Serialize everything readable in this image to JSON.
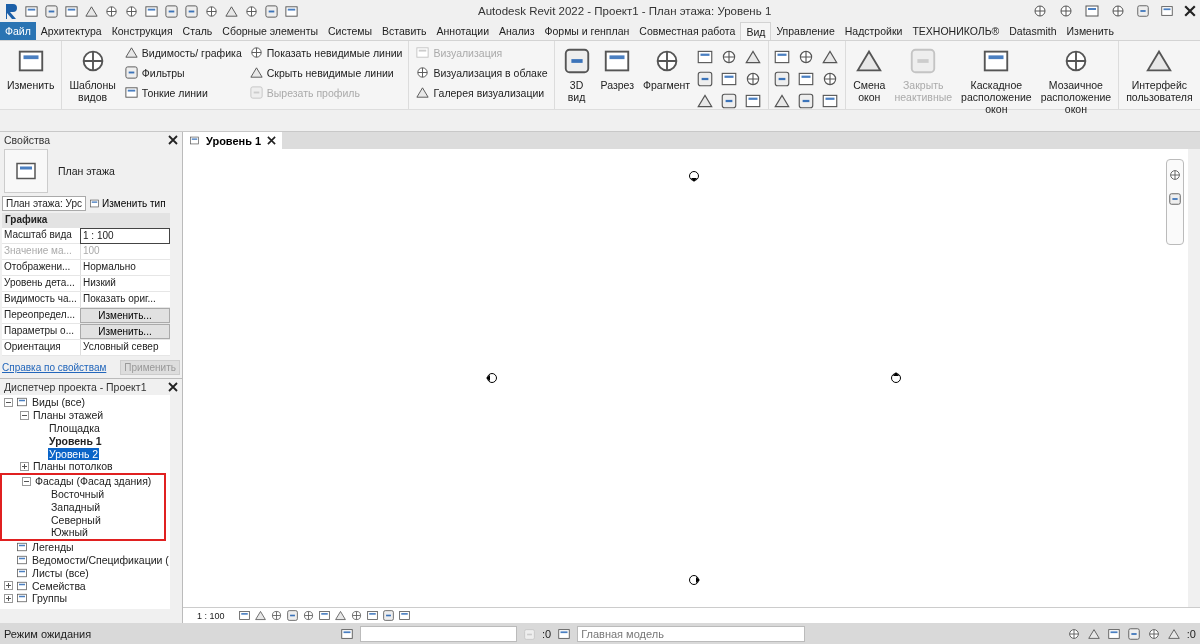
{
  "window": {
    "title": "Autodesk Revit 2022 - Проект1 - План этажа: Уровень 1"
  },
  "ribbon_tabs": [
    {
      "label": "Файл",
      "kind": "app",
      "selected": false
    },
    {
      "label": "Архитектура",
      "kind": "tab",
      "selected": false
    },
    {
      "label": "Конструкция",
      "kind": "tab",
      "selected": false
    },
    {
      "label": "Сталь",
      "kind": "tab",
      "selected": false
    },
    {
      "label": "Сборные элементы",
      "kind": "tab",
      "selected": false
    },
    {
      "label": "Системы",
      "kind": "tab",
      "selected": false
    },
    {
      "label": "Вставить",
      "kind": "tab",
      "selected": false
    },
    {
      "label": "Аннотации",
      "kind": "tab",
      "selected": false
    },
    {
      "label": "Анализ",
      "kind": "tab",
      "selected": false
    },
    {
      "label": "Формы и генплан",
      "kind": "tab",
      "selected": false
    },
    {
      "label": "Совместная работа",
      "kind": "tab",
      "selected": false
    },
    {
      "label": "Вид",
      "kind": "tab",
      "selected": true
    },
    {
      "label": "Управление",
      "kind": "tab",
      "selected": false
    },
    {
      "label": "Надстройки",
      "kind": "tab",
      "selected": false
    },
    {
      "label": "ТЕХНОНИКОЛЬ®",
      "kind": "tab",
      "selected": false
    },
    {
      "label": "Datasmith",
      "kind": "tab",
      "selected": false
    },
    {
      "label": "Изменить",
      "kind": "tab",
      "selected": false
    }
  ],
  "ribbon_groups": [
    {
      "items": [
        {
          "kind": "large",
          "label": "Изменить",
          "disabled": false
        }
      ]
    },
    {
      "items": [
        {
          "kind": "large",
          "label": "Шаблоны видов",
          "disabled": false
        },
        {
          "kind": "stack",
          "items": [
            {
              "label": "Видимость/ графика",
              "disabled": false
            },
            {
              "label": "Фильтры",
              "disabled": false
            },
            {
              "label": "Тонкие линии",
              "disabled": false
            }
          ]
        },
        {
          "kind": "stack",
          "items": [
            {
              "label": "Показать невидимые линии",
              "disabled": false
            },
            {
              "label": "Скрыть невидимые линии",
              "disabled": false
            },
            {
              "label": "Вырезать профиль",
              "disabled": true
            }
          ]
        }
      ]
    },
    {
      "items": [
        {
          "kind": "stack",
          "items": [
            {
              "label": "Визуализация",
              "disabled": true
            },
            {
              "label": "Визуализация  в облаке",
              "disabled": false
            },
            {
              "label": "Галерея  визуализации",
              "disabled": false
            }
          ]
        }
      ]
    },
    {
      "items": [
        {
          "kind": "large",
          "label": "3D вид",
          "disabled": false
        },
        {
          "kind": "large",
          "label": "Разрез",
          "disabled": false
        },
        {
          "kind": "large",
          "label": "Фрагмент",
          "disabled": false
        },
        {
          "kind": "icons"
        }
      ]
    },
    {
      "items": [
        {
          "kind": "icons"
        }
      ]
    },
    {
      "items": [
        {
          "kind": "large",
          "label": "Смена окон",
          "disabled": false
        },
        {
          "kind": "large",
          "label": "Закрыть неактивные",
          "disabled": true
        },
        {
          "kind": "large",
          "label": "Каскадное расположение окон",
          "disabled": false
        },
        {
          "kind": "large",
          "label": "Мозаичное расположение окон",
          "disabled": false
        }
      ]
    },
    {
      "items": [
        {
          "kind": "large",
          "label": "Интерфейс пользователя",
          "disabled": false
        }
      ]
    }
  ],
  "properties": {
    "title": "Свойства",
    "type_name": "План этажа",
    "instance_selector": "План этажа: Урс",
    "edit_type": "Изменить тип",
    "section": "Графика",
    "rows": [
      {
        "label": "Масштаб вида",
        "value": "1 : 100",
        "kind": "input",
        "disabled": false
      },
      {
        "label": "Значение ма...",
        "value": "100",
        "kind": "text",
        "disabled": true
      },
      {
        "label": "Отображени...",
        "value": "Нормально",
        "kind": "text",
        "disabled": false
      },
      {
        "label": "Уровень дета...",
        "value": "Низкий",
        "kind": "text",
        "disabled": false
      },
      {
        "label": "Видимость ча...",
        "value": "Показать ориг...",
        "kind": "text",
        "disabled": false
      },
      {
        "label": "Переопредел...",
        "value": "Изменить...",
        "kind": "button",
        "disabled": false
      },
      {
        "label": "Параметры о...",
        "value": "Изменить...",
        "kind": "button",
        "disabled": false
      },
      {
        "label": "Ориентация",
        "value": "Условный север",
        "kind": "text",
        "disabled": false
      }
    ],
    "help_link": "Справка по свойствам",
    "apply_button": {
      "label": "Применить",
      "disabled": true
    }
  },
  "project_browser": {
    "title": "Диспетчер проекта - Проект1",
    "tree": [
      {
        "label": "Виды (все)",
        "expanded": true,
        "selected": false,
        "current": false,
        "highlighted": false,
        "children": [
          {
            "label": "Планы этажей",
            "expanded": true,
            "selected": false,
            "current": false,
            "highlighted": false,
            "children": [
              {
                "label": "Площадка",
                "selected": false,
                "current": false,
                "highlighted": false
              },
              {
                "label": "Уровень 1",
                "selected": false,
                "current": true,
                "highlighted": false
              },
              {
                "label": "Уровень 2",
                "selected": true,
                "current": false,
                "highlighted": false
              }
            ]
          },
          {
            "label": "Планы потолков",
            "expanded": false,
            "selected": false,
            "current": false,
            "highlighted": false
          },
          {
            "label": "Фасады (Фасад здания)",
            "expanded": true,
            "selected": false,
            "current": false,
            "highlighted": true,
            "children": [
              {
                "label": "Восточный",
                "selected": false,
                "current": false,
                "highlighted": false
              },
              {
                "label": "Западный",
                "selected": false,
                "current": false,
                "highlighted": false
              },
              {
                "label": "Северный",
                "selected": false,
                "current": false,
                "highlighted": false
              },
              {
                "label": "Южный",
                "selected": false,
                "current": false,
                "highlighted": false
              }
            ]
          }
        ]
      },
      {
        "label": "Легенды",
        "selected": false,
        "current": false,
        "highlighted": false
      },
      {
        "label": "Ведомости/Спецификации (",
        "selected": false,
        "current": false,
        "highlighted": false
      },
      {
        "label": "Листы (все)",
        "selected": false,
        "current": false,
        "highlighted": false
      },
      {
        "label": "Семейства",
        "expanded": false,
        "selected": false,
        "current": false,
        "highlighted": false
      },
      {
        "label": "Группы",
        "expanded": false,
        "selected": false,
        "current": false,
        "highlighted": false
      }
    ]
  },
  "view_tabs": [
    {
      "label": "Уровень 1",
      "selected": true
    }
  ],
  "view_control_bar": {
    "scale": "1 : 100"
  },
  "status_bar": {
    "message": "Режим ожидания",
    "workset_count": ":0",
    "design_option": "Главная модель",
    "filter_count": ":0"
  }
}
